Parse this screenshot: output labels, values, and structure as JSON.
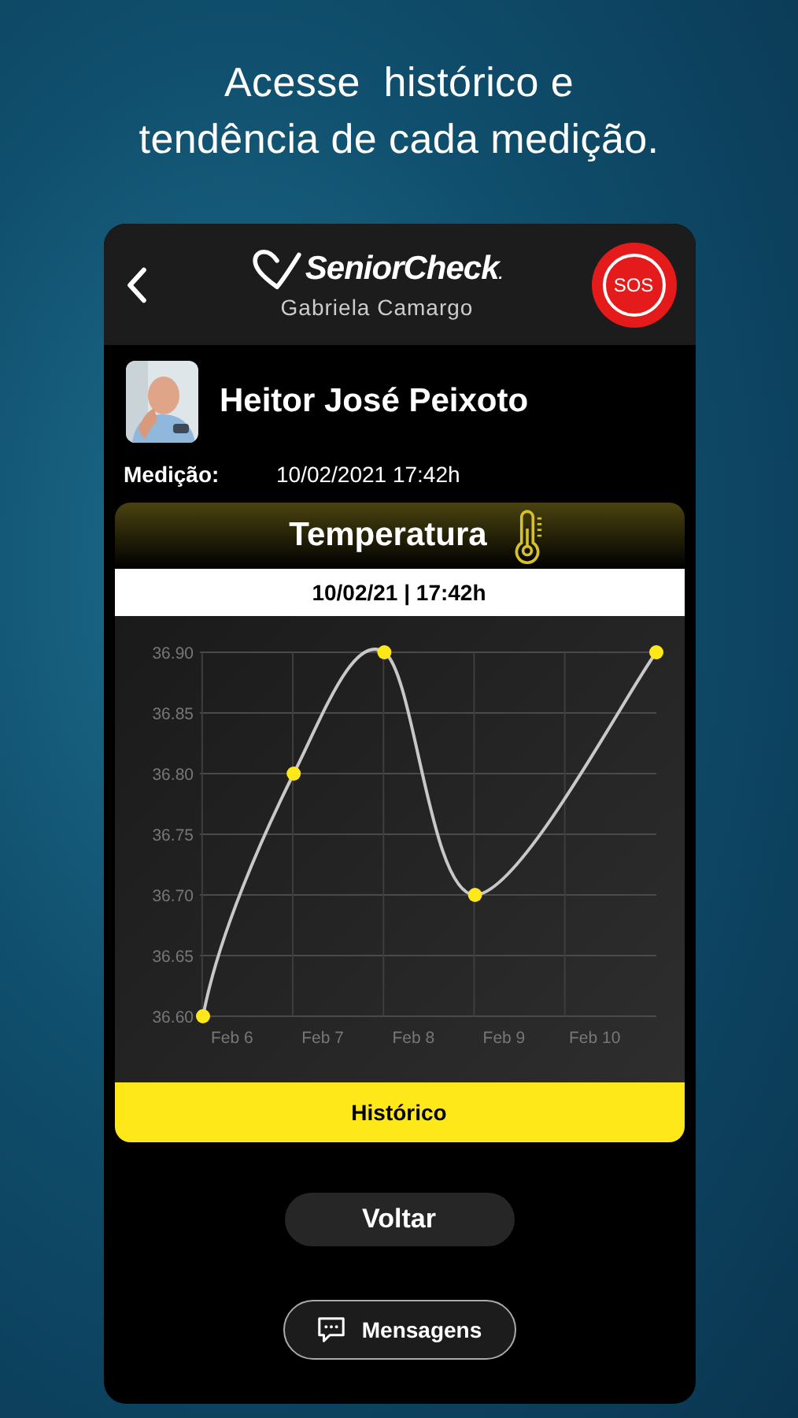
{
  "headline": "Acesse  histórico e\ntendência de cada medição.",
  "header": {
    "logo": "SeniorCheck",
    "logo_mark": ".",
    "caregiver": "Gabriela Camargo",
    "sos": "SOS"
  },
  "patient": {
    "name": "Heitor José Peixoto"
  },
  "measurement": {
    "label": "Medição:",
    "value": "10/02/2021 17:42h"
  },
  "card": {
    "title": "Temperatura",
    "date": "10/02/21 | 17:42h",
    "chart_data": {
      "type": "line",
      "grid": true,
      "categories": [
        "Feb 6",
        "Feb 7",
        "Feb 8",
        "Feb 9",
        "Feb 10",
        null
      ],
      "series": [
        {
          "color": "#ffe81a",
          "marker": "circle",
          "values": [
            36.6,
            36.8,
            36.9,
            36.7,
            null,
            36.9
          ]
        }
      ],
      "ylim": [
        36.6,
        36.9
      ],
      "yticks": [
        {
          "value": 36.9,
          "label": "36.90"
        },
        {
          "value": 36.85,
          "label": "36.85"
        },
        {
          "value": 36.8,
          "label": "36.80"
        },
        {
          "value": 36.75,
          "label": "36.75"
        },
        {
          "value": 36.7,
          "label": "36.70"
        },
        {
          "value": 36.65,
          "label": "36.65"
        },
        {
          "value": 36.6,
          "label": "36.60"
        }
      ]
    },
    "history_button": "Histórico"
  },
  "buttons": [
    {
      "kind": "back",
      "label": "Voltar"
    },
    {
      "kind": "messages",
      "label": "Mensagens"
    }
  ]
}
